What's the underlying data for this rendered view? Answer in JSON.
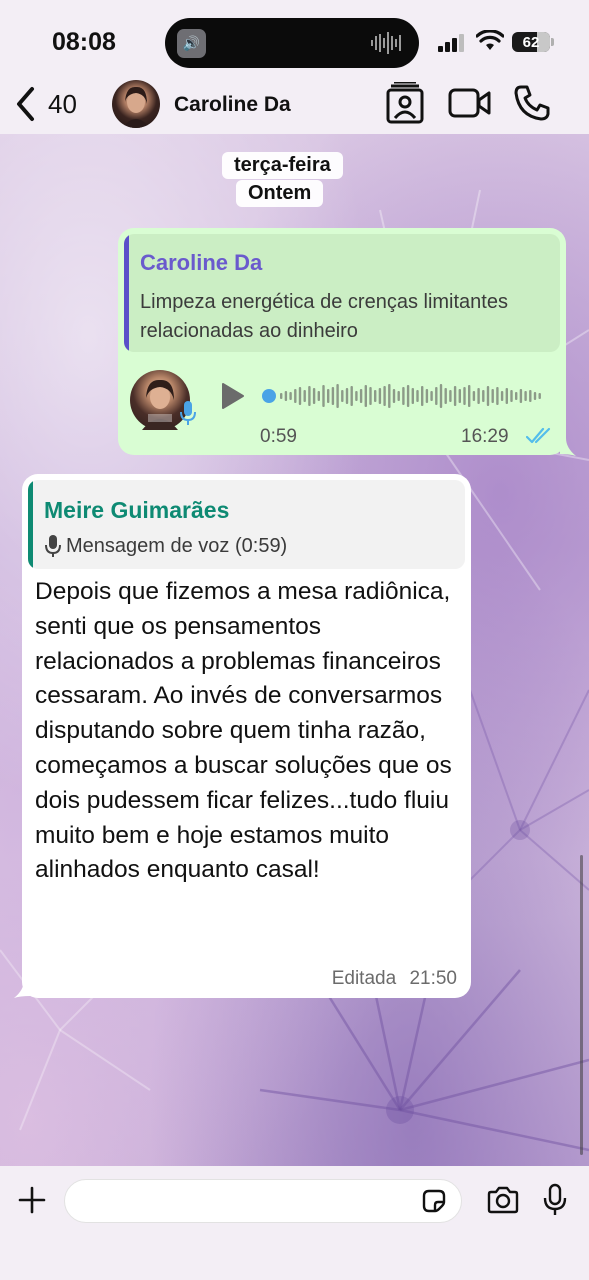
{
  "status_bar": {
    "time": "08:08",
    "battery": "62",
    "battery_level": 0.62
  },
  "header": {
    "back_count": "40",
    "contact_name": "Caroline Da",
    "icons": [
      "chevron-left-icon",
      "contact-card-icon",
      "video-camera-icon",
      "phone-icon"
    ]
  },
  "chat": {
    "date_chips": [
      "terça-feira",
      "Ontem"
    ],
    "outgoing": {
      "quote_author": "Caroline Da",
      "quote_text": "Limpeza energética de crenças limitantes relacionadas ao dinheiro",
      "voice_duration": "0:59",
      "time": "16:29",
      "status": "read",
      "tick_color": "#53bdeb"
    },
    "incoming": {
      "quote_author": "Meire Guimarães",
      "quote_text": "Mensagem de voz (0:59)",
      "text": "Depois que fizemos a mesa radiônica, senti que os pensamentos relacionados a problemas financeiros cessaram. Ao invés de conversarmos disputando sobre quem tinha razão, começamos a buscar soluções que os dois pudessem ficar felizes...tudo fluiu muito bem e hoje estamos muito alinhados enquanto casal!",
      "edited_label": "Editada",
      "time": "21:50"
    }
  },
  "composer": {
    "placeholder": "",
    "icons": [
      "plus-icon",
      "sticker-icon",
      "camera-icon",
      "microphone-icon"
    ]
  },
  "colors": {
    "outgoing_bubble": "#d9fdd3",
    "incoming_bubble": "#ffffff",
    "quote_out_name": "#6a5acd",
    "quote_in_name": "#0e8a73"
  }
}
